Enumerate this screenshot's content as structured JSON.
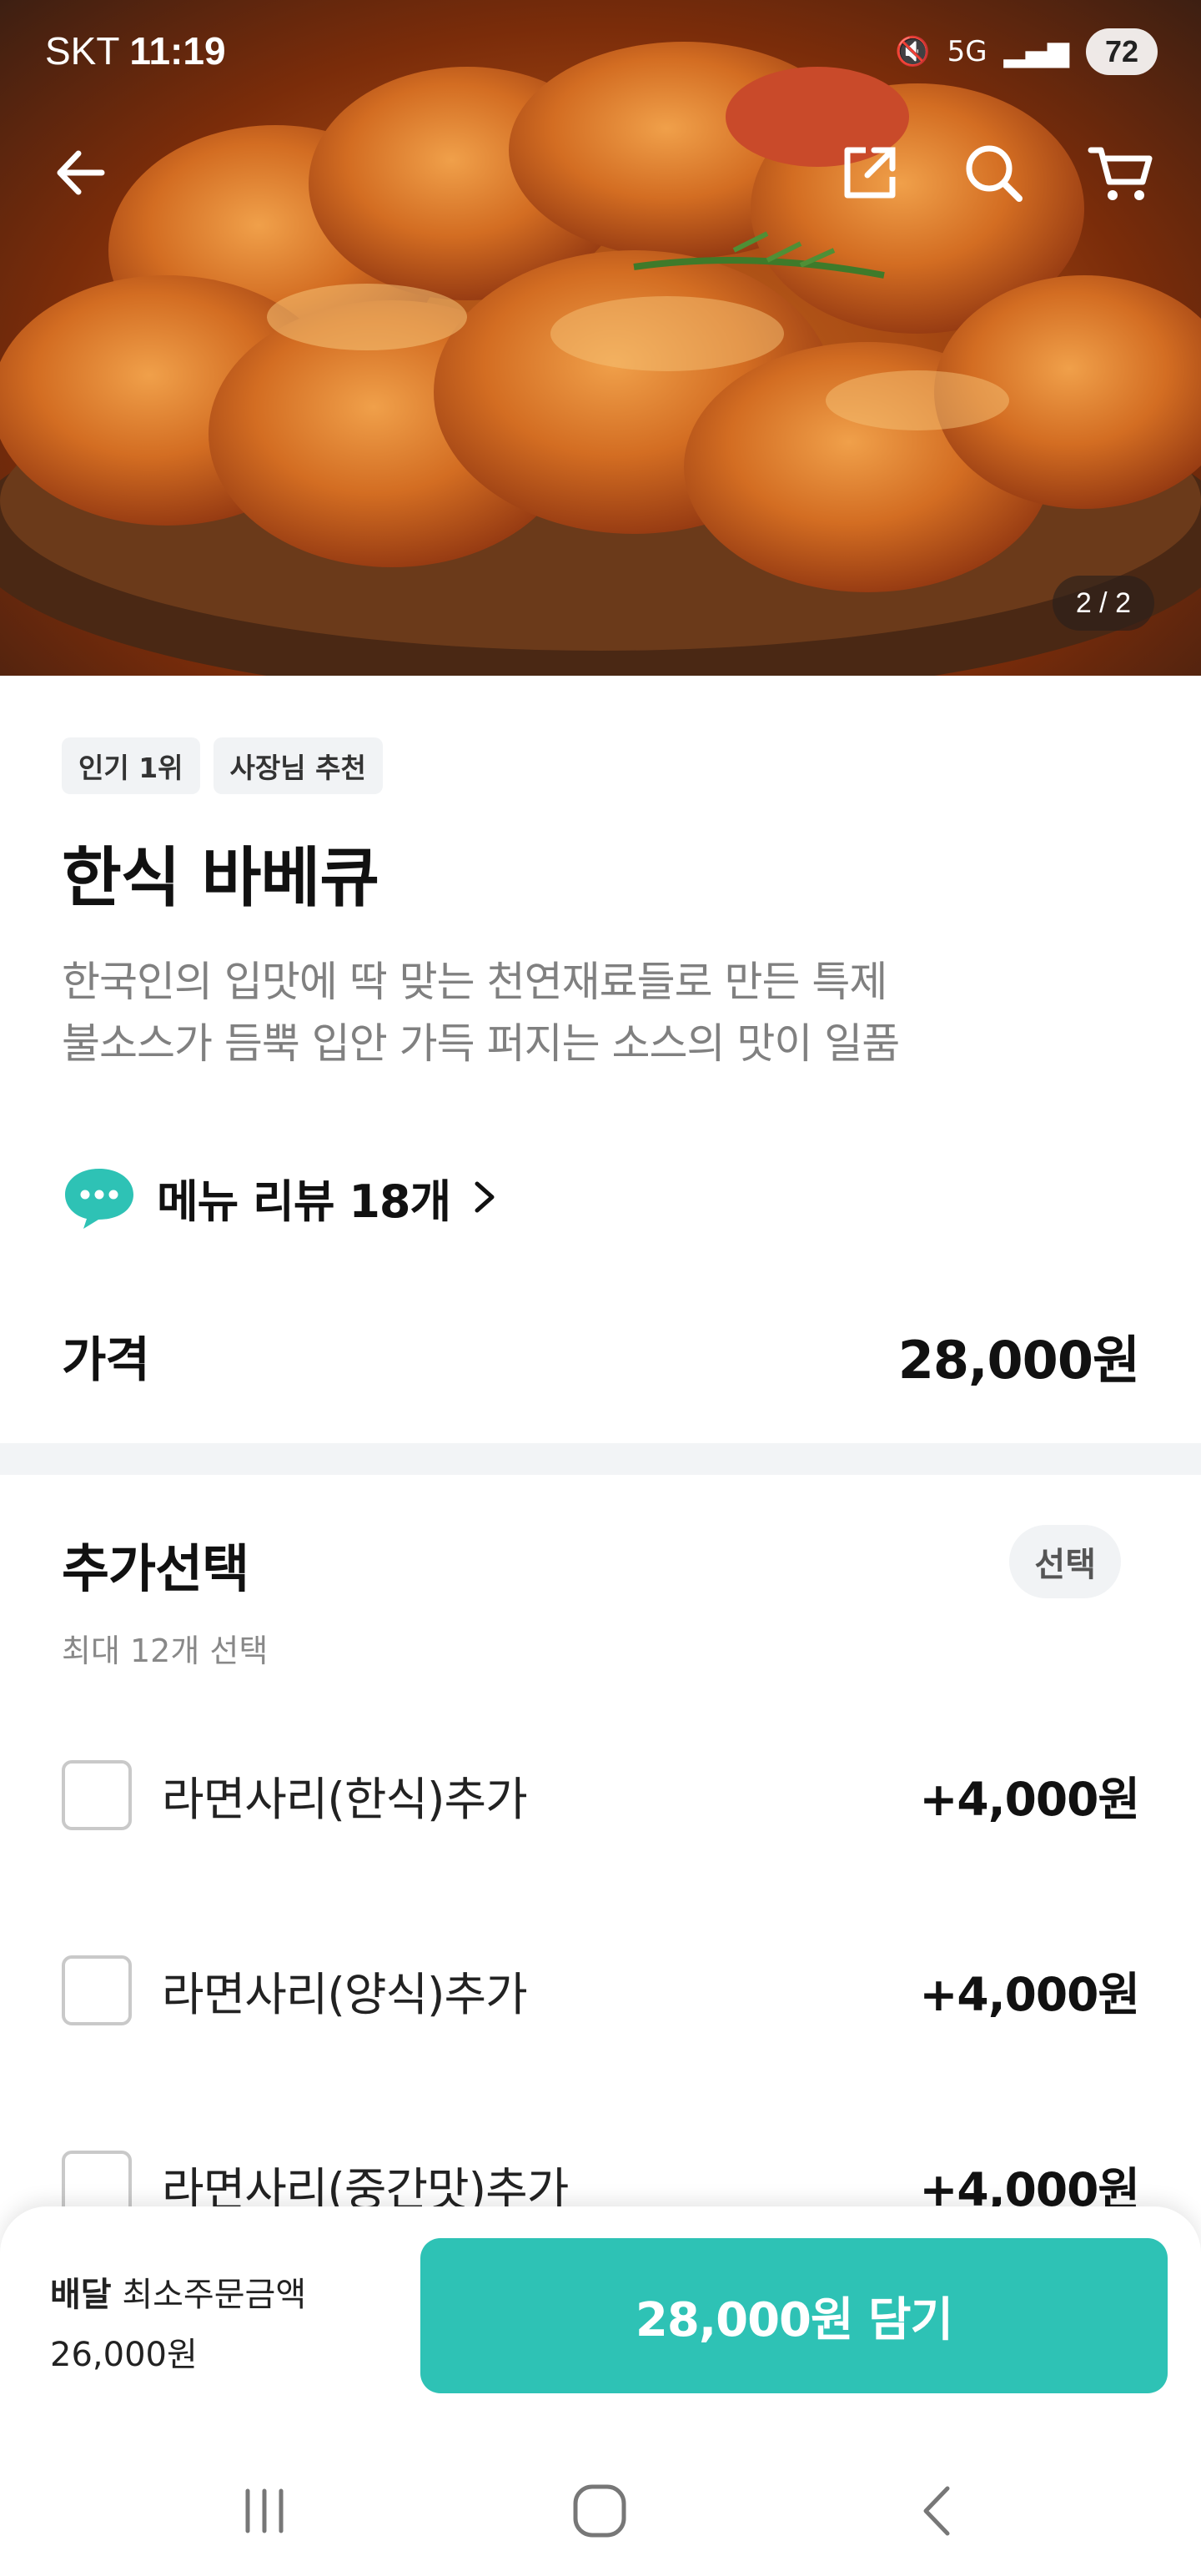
{
  "status_bar": {
    "carrier": "SKT",
    "time": "11:19",
    "network": "5G",
    "battery": "72"
  },
  "hero": {
    "image_counter": "2 / 2"
  },
  "menu": {
    "badges": [
      "인기 1위",
      "사장님 추천"
    ],
    "title": "한식 바베큐",
    "description_line1": "한국인의 입맛에 딱 맞는 천연재료들로 만든 특제",
    "description_line2": "불소스가 듬뿍 입안 가득 퍼지는 소스의 맛이 일품",
    "review_label": "메뉴 리뷰 18개",
    "price_label": "가격",
    "price_value": "28,000원"
  },
  "options": {
    "title": "추가선택",
    "badge": "선택",
    "subtitle": "최대 12개 선택",
    "items": [
      {
        "name": "라면사리(한식)추가",
        "price": "+4,000원"
      },
      {
        "name": "라면사리(양식)추가",
        "price": "+4,000원"
      },
      {
        "name": "라면사리(중간맛)추가",
        "price": "+4,000원"
      }
    ]
  },
  "bottom_bar": {
    "delivery_label": "배달",
    "min_order_label": "최소주문금액",
    "min_order_value": "26,000원",
    "add_button": "28,000원 담기"
  },
  "colors": {
    "accent": "#2ec2b5",
    "divider": "#f2f4f6",
    "badge_bg": "#f1f3f5"
  },
  "icons": [
    "back-arrow-icon",
    "share-icon",
    "search-icon",
    "cart-icon",
    "chat-bubble-icon",
    "chevron-right-icon",
    "recents-icon",
    "home-icon",
    "back-icon"
  ]
}
